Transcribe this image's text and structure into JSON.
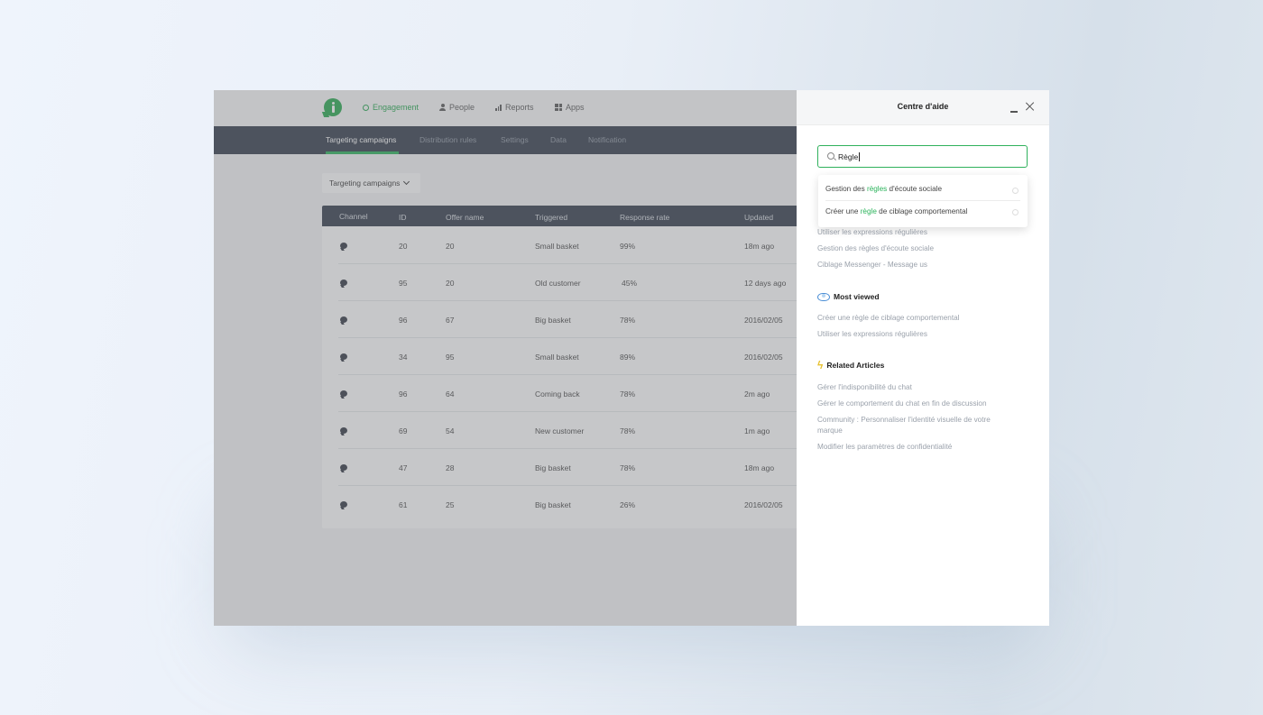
{
  "topnav": {
    "items": [
      {
        "label": "Engagement",
        "icon": "target-icon"
      },
      {
        "label": "People",
        "icon": "person-icon"
      },
      {
        "label": "Reports",
        "icon": "bar-chart-icon"
      },
      {
        "label": "Apps",
        "icon": "grid-icon"
      }
    ]
  },
  "subnav": {
    "items": [
      {
        "label": "Targeting campaigns"
      },
      {
        "label": "Distribution rules"
      },
      {
        "label": "Settings"
      },
      {
        "label": "Data"
      },
      {
        "label": "Notification"
      }
    ]
  },
  "filter": {
    "label": "Targeting campaigns"
  },
  "table": {
    "headers": [
      "Channel",
      "ID",
      "Offer name",
      "Triggered",
      "Response rate",
      "Updated"
    ],
    "rows": [
      {
        "id": "20",
        "offer": "20",
        "triggered": "Small basket",
        "rate": "99%",
        "updated": "18m ago"
      },
      {
        "id": "95",
        "offer": "20",
        "triggered": "Old customer",
        "rate": "45%",
        "updated": "12 days ago"
      },
      {
        "id": "96",
        "offer": "67",
        "triggered": "Big basket",
        "rate": "78%",
        "updated": "2016/02/05"
      },
      {
        "id": "34",
        "offer": "95",
        "triggered": "Small basket",
        "rate": "89%",
        "updated": "2016/02/05"
      },
      {
        "id": "96",
        "offer": "64",
        "triggered": "Coming back",
        "rate": "78%",
        "updated": "2m ago"
      },
      {
        "id": "69",
        "offer": "54",
        "triggered": "New customer",
        "rate": "78%",
        "updated": "1m ago"
      },
      {
        "id": "47",
        "offer": "28",
        "triggered": "Big basket",
        "rate": "78%",
        "updated": "18m ago"
      },
      {
        "id": "61",
        "offer": "25",
        "triggered": "Big basket",
        "rate": "26%",
        "updated": "2016/02/05"
      }
    ]
  },
  "help": {
    "title": "Centre d'aide",
    "search": {
      "value": "Règle"
    },
    "suggestions": [
      {
        "before": "Gestion des ",
        "highlight": "règles",
        "after": " d'écoute sociale"
      },
      {
        "before": "Créer une ",
        "highlight": "règle",
        "after": " de ciblage comportemental"
      }
    ],
    "recent": [
      "Utiliser les expressions régulières",
      "Gestion des règles d'écoute sociale",
      "Ciblage Messenger - Message us"
    ],
    "most_viewed": {
      "title": "Most viewed",
      "links": [
        "Créer une règle de ciblage comportemental",
        "Utiliser les expressions régulières"
      ]
    },
    "related": {
      "title": "Related Articles",
      "links": [
        "Gérer l'indisponibilité du chat",
        "Gérer le comportement du chat en fin de discussion",
        "Community : Personnaliser l'identité visuelle de votre marque",
        "Modifier les paramètres de confidentialité"
      ]
    }
  }
}
